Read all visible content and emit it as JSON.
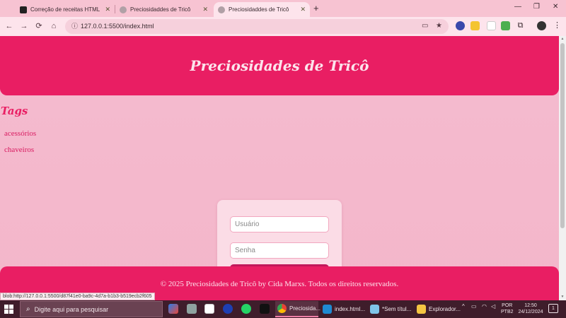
{
  "browser": {
    "tabs": [
      {
        "title": "Correção de receitas HTML",
        "active": false
      },
      {
        "title": "Preciosidaddes de Tricô",
        "active": false
      },
      {
        "title": "Preciosidaddes de Tricô",
        "active": true
      }
    ],
    "close_glyph": "✕",
    "new_tab_glyph": "+",
    "window_controls": [
      "—",
      "❐",
      "✕"
    ],
    "nav": {
      "back": "←",
      "forward": "→",
      "reload": "⟳",
      "home": "⌂"
    },
    "url": "127.0.0.1:5500/index.html",
    "extensions": [
      "chrome-icon",
      "puzzle-icon",
      "profile-icon"
    ]
  },
  "page": {
    "site_title": "Preciosidades de Tricô",
    "tags_heading": "Tags",
    "tags": [
      "acessórios",
      "chaveiros"
    ],
    "login": {
      "username_placeholder": "Usuário",
      "password_placeholder": "Senha"
    },
    "footer": "© 2025 Preciosidades de Tricô by Cida Marxs. Todos os direitos reservados.",
    "status_url": "blob:http://127.0.0.1:5500/d87f41e0-ba9c-4d7a-b1b3-b519ecb2f605"
  },
  "taskbar": {
    "search_placeholder": "Digite aqui para pesquisar",
    "apps": [
      {
        "label": "Preciosida...",
        "active": true
      },
      {
        "label": "index.html...",
        "active": false
      },
      {
        "label": "*Sem títul...",
        "active": false
      },
      {
        "label": "Explorador...",
        "active": false
      }
    ],
    "lang_line1": "POR",
    "lang_line2": "PTB2",
    "time": "12:50",
    "date": "24/12/2024",
    "notifications": "1"
  },
  "colors": {
    "brand": "#e91e63",
    "page_bg": "#f4b9cc",
    "button": "#c2185b"
  }
}
